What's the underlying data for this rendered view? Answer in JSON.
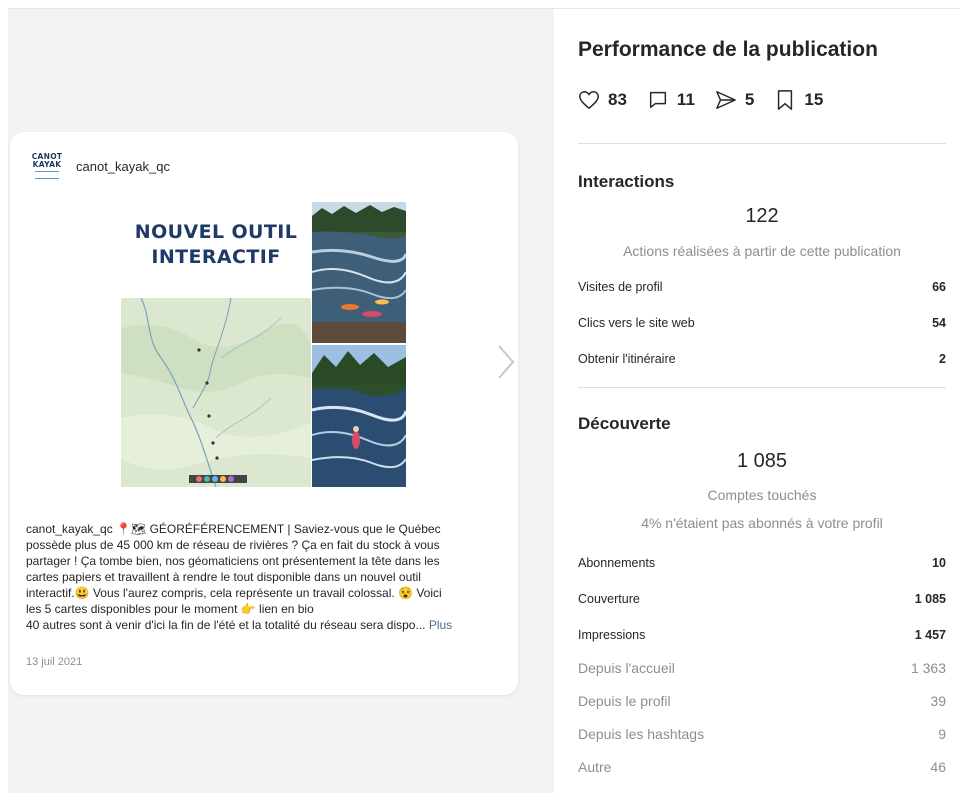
{
  "post": {
    "username": "canot_kayak_qc",
    "avatar_lines": [
      "CANOT",
      "KAYAK"
    ],
    "image_headline": [
      "NOUVEL OUTIL",
      "INTERACTIF"
    ],
    "caption_user": "canot_kayak_qc",
    "caption_lines": [
      "📍🗺 GÉORÉFÉRENCEMENT | Saviez-vous que le Québec",
      "possède plus de 45 000 km de réseau de rivières ? Ça en fait du stock à vous",
      "partager ! Ça tombe bien, nos géomaticiens ont présentement la tête dans les",
      "cartes papiers et travaillent à rendre le tout disponible dans un nouvel outil",
      "interactif.😃 Vous l'aurez compris, cela représente un travail colossal. 😵 Voici",
      "les 5 cartes disponibles pour le moment 👉 lien en bio",
      "40 autres sont à venir d'ici la fin de l'été et la totalité du réseau sera dispo..."
    ],
    "more_label": "Plus",
    "date": "13 juil 2021"
  },
  "performance": {
    "title": "Performance de la publication",
    "metrics": {
      "likes": "83",
      "comments": "11",
      "shares": "5",
      "saves": "15"
    }
  },
  "interactions": {
    "title": "Interactions",
    "total": "122",
    "subtitle": "Actions réalisées à partir de cette publication",
    "rows": [
      {
        "label": "Visites de profil",
        "value": "66"
      },
      {
        "label": "Clics vers le site web",
        "value": "54"
      },
      {
        "label": "Obtenir l'itinéraire",
        "value": "2"
      }
    ]
  },
  "discovery": {
    "title": "Découverte",
    "total": "1 085",
    "subtitle": "Comptes touchés",
    "note": "4% n'étaient pas abonnés à votre profil",
    "rows": [
      {
        "label": "Abonnements",
        "value": "10"
      },
      {
        "label": "Couverture",
        "value": "1 085"
      },
      {
        "label": "Impressions",
        "value": "1 457"
      }
    ],
    "sources": [
      {
        "label": "Depuis l'accueil",
        "value": "1 363"
      },
      {
        "label": "Depuis le profil",
        "value": "39"
      },
      {
        "label": "Depuis les hashtags",
        "value": "9"
      },
      {
        "label": "Autre",
        "value": "46"
      }
    ]
  }
}
